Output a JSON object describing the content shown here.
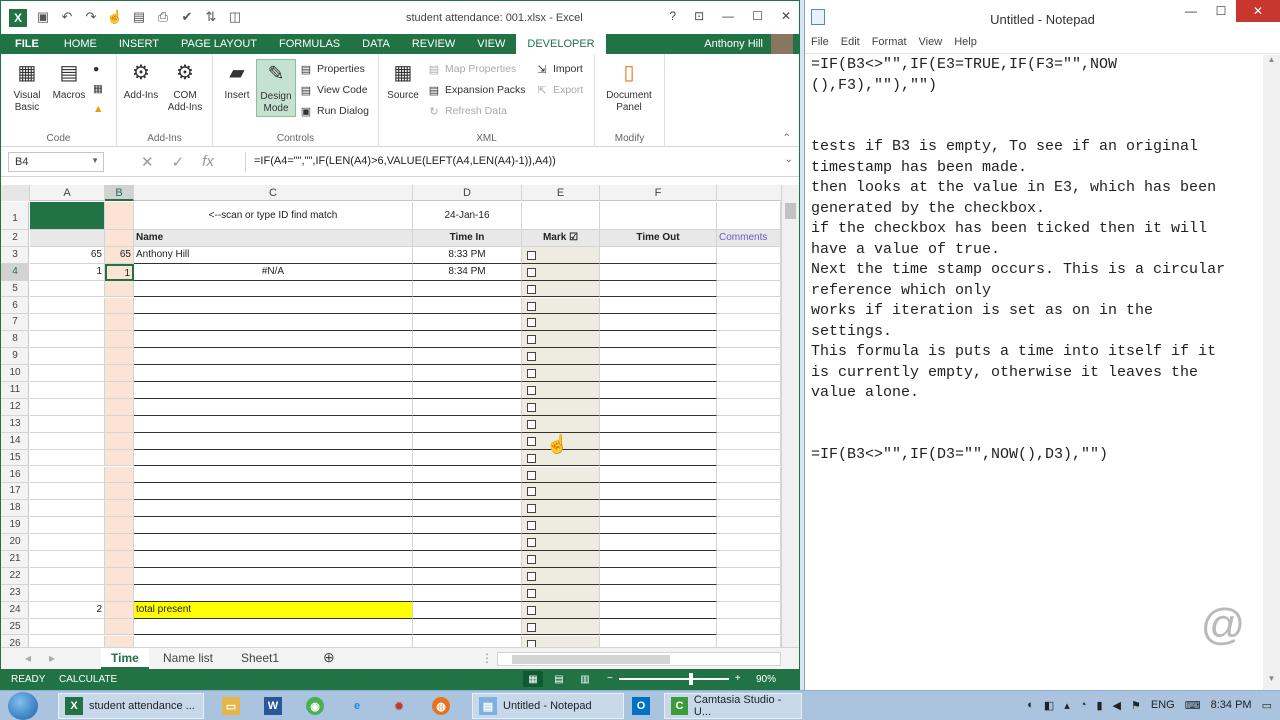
{
  "excel": {
    "title": "student attendance: 001.xlsx - Excel",
    "tabs": [
      "FILE",
      "HOME",
      "INSERT",
      "PAGE LAYOUT",
      "FORMULAS",
      "DATA",
      "REVIEW",
      "VIEW",
      "DEVELOPER"
    ],
    "active_tab": "DEVELOPER",
    "user": "Anthony Hill",
    "ribbon": {
      "code": {
        "label": "Code",
        "visual_basic": "Visual Basic",
        "macros": "Macros"
      },
      "addins": {
        "label": "Add-Ins",
        "addins": "Add-Ins",
        "com_addins": "COM Add-Ins"
      },
      "controls": {
        "label": "Controls",
        "insert": "Insert",
        "design_mode": "Design Mode",
        "properties": "Properties",
        "view_code": "View Code",
        "run_dialog": "Run Dialog"
      },
      "xml": {
        "label": "XML",
        "source": "Source",
        "map_properties": "Map Properties",
        "expansion_packs": "Expansion Packs",
        "refresh_data": "Refresh Data",
        "import": "Import",
        "export": "Export"
      },
      "modify": {
        "label": "Modify",
        "document_panel": "Document Panel"
      }
    },
    "name_box": "B4",
    "formula": "=IF(A4=\"\",\"\",IF(LEN(A4)>6,VALUE(LEFT(A4,LEN(A4)-1)),A4))",
    "columns": [
      "A",
      "B",
      "C",
      "D",
      "E",
      "F"
    ],
    "rows": [
      "1",
      "2",
      "3",
      "4",
      "5",
      "6",
      "7",
      "8",
      "9",
      "10",
      "11",
      "12",
      "13",
      "14",
      "15",
      "16",
      "17",
      "18",
      "19",
      "20",
      "21",
      "22",
      "23",
      "24",
      "25",
      "26"
    ],
    "cells": {
      "c1": "<--scan or type ID find match",
      "d1": "24-Jan-16",
      "c2": "Name",
      "d2": "Time In",
      "e2": "Mark ☑",
      "f2": "Time Out",
      "g2": "Comments",
      "a3": "65",
      "b3": "65",
      "c3": "Anthony Hill",
      "d3": "8:33 PM",
      "a4": "1",
      "b4": "1",
      "c4": "#N/A",
      "d4": "8:34 PM",
      "a24": "2",
      "c24": "total present"
    },
    "sheet_tabs": [
      "Time",
      "Name list",
      "Sheet1"
    ],
    "active_sheet": "Time",
    "status": {
      "ready": "READY",
      "calculate": "CALCULATE",
      "zoom": "90%"
    }
  },
  "notepad": {
    "title": "Untitled - Notepad",
    "menu": [
      "File",
      "Edit",
      "Format",
      "View",
      "Help"
    ],
    "text": "=IF(B3<>\"\",IF(E3=TRUE,IF(F3=\"\",NOW\n(),F3),\"\"),\"\")\n\n\ntests if B3 is empty, To see if an original\ntimestamp has been made.\nthen looks at the value in E3, which has been\ngenerated by the checkbox.\nif the checkbox has been ticked then it will\nhave a value of true.\nNext the time stamp occurs. This is a circular\nreference which only\nworks if iteration is set as on in the\nsettings.\nThis formula is puts a time into itself if it\nis currently empty, otherwise it leaves the\nvalue alone.\n\n\n=IF(B3<>\"\",IF(D3=\"\",NOW(),D3),\"\")"
  },
  "taskbar": {
    "apps": [
      "student attendance ...",
      "Untitled - Notepad",
      "Camtasia Studio - U..."
    ],
    "lang": "ENG",
    "time": "8:34 PM"
  },
  "colors": {
    "excel_green": "#217346",
    "highlight": "#ffff00",
    "b_col": "#fbe4d5",
    "e_col": "#eeebe1"
  }
}
